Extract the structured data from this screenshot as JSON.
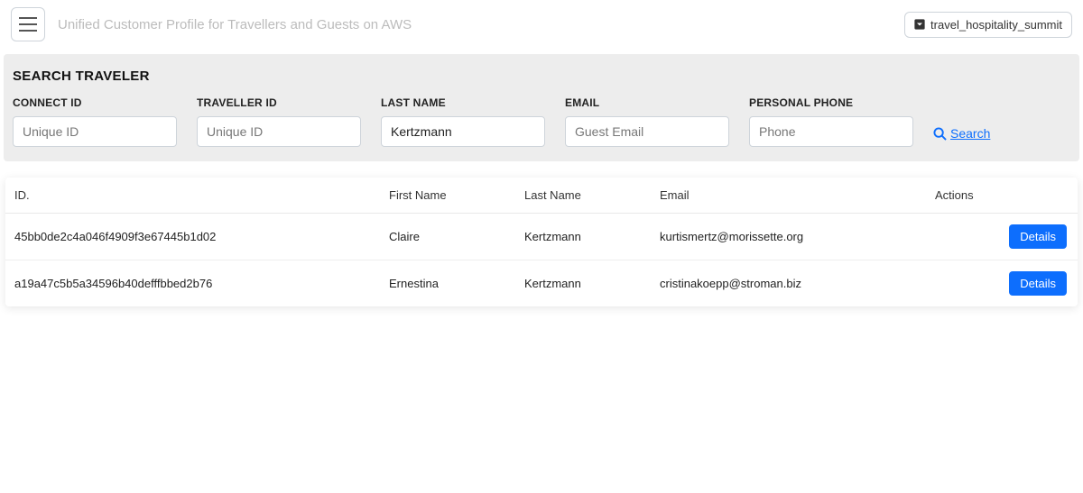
{
  "header": {
    "app_title": "Unified Customer Profile for Travellers and Guests on AWS",
    "domain_selected": "travel_hospitality_summit"
  },
  "search_panel": {
    "title": "SEARCH TRAVELER",
    "fields": {
      "connect_id": {
        "label": "CONNECT ID",
        "placeholder": "Unique ID",
        "value": ""
      },
      "traveller_id": {
        "label": "TRAVELLER ID",
        "placeholder": "Unique ID",
        "value": ""
      },
      "last_name": {
        "label": "LAST NAME",
        "placeholder": "",
        "value": "Kertzmann"
      },
      "email": {
        "label": "EMAIL",
        "placeholder": "Guest Email",
        "value": ""
      },
      "phone": {
        "label": "PERSONAL PHONE",
        "placeholder": "Phone",
        "value": ""
      }
    },
    "search_link": "Search"
  },
  "results": {
    "columns": {
      "id": "ID.",
      "first_name": "First Name",
      "last_name": "Last Name",
      "email": "Email",
      "actions": "Actions"
    },
    "details_label": "Details",
    "rows": [
      {
        "id": "45bb0de2c4a046f4909f3e67445b1d02",
        "first_name": "Claire",
        "last_name": "Kertzmann",
        "email": "kurtismertz@morissette.org"
      },
      {
        "id": "a19a47c5b5a34596b40defffbbed2b76",
        "first_name": "Ernestina",
        "last_name": "Kertzmann",
        "email": "cristinakoepp@stroman.biz"
      }
    ]
  }
}
